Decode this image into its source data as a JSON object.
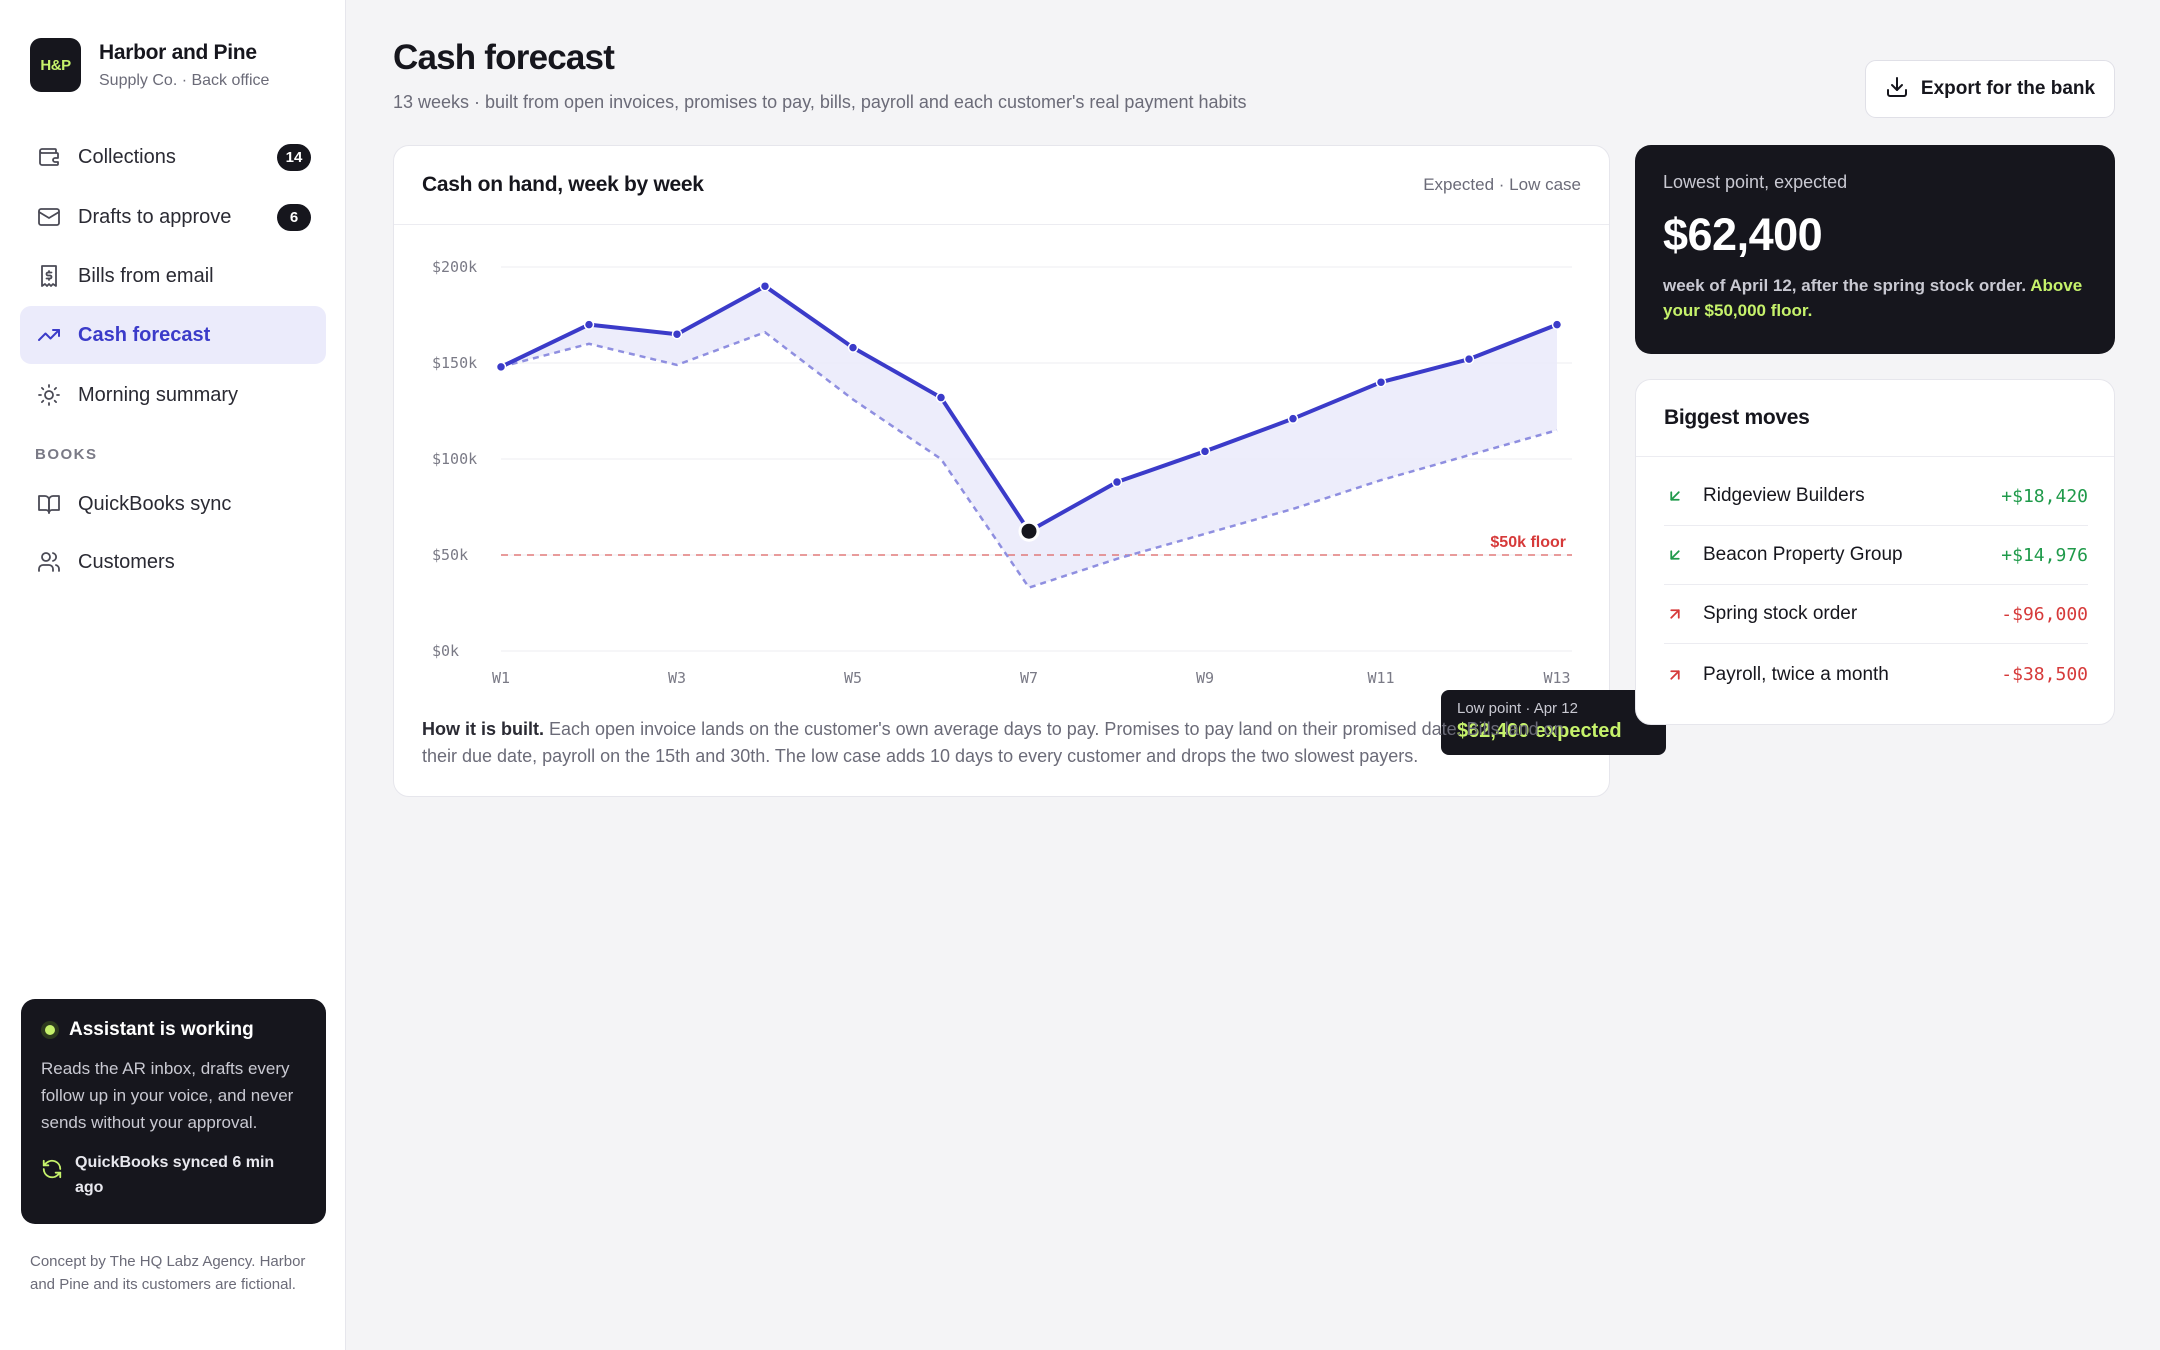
{
  "brand": {
    "logo": "H&P",
    "name": "Harbor and Pine",
    "sub": "Supply Co. · Back office"
  },
  "nav": {
    "items": [
      {
        "label": "Collections",
        "icon": "wallet-icon",
        "badge": "14"
      },
      {
        "label": "Drafts to approve",
        "icon": "mail-icon",
        "badge": "6"
      },
      {
        "label": "Bills from email",
        "icon": "receipt-icon"
      },
      {
        "label": "Cash forecast",
        "icon": "trend-icon",
        "active": true
      },
      {
        "label": "Morning summary",
        "icon": "sun-icon"
      }
    ],
    "books_heading": "BOOKS",
    "books": [
      {
        "label": "QuickBooks sync",
        "icon": "book-icon"
      },
      {
        "label": "Customers",
        "icon": "users-icon"
      }
    ]
  },
  "assistant": {
    "title": "Assistant is working",
    "body": "Reads the AR inbox, drafts every follow up in your voice, and never sends without your approval.",
    "sync": "QuickBooks synced 6 min ago"
  },
  "credit": "Concept by The HQ Labz Agency. Harbor and Pine and its customers are fictional.",
  "header": {
    "title": "Cash forecast",
    "subtitle": "13 weeks · built from open invoices, promises to pay, bills, payroll and each customer's real payment habits",
    "export_label": "Export for the bank"
  },
  "chart_card": {
    "title": "Cash on hand, week by week",
    "legend": "Expected · Low case",
    "tooltip_label": "Low point · Apr 12",
    "tooltip_value": "$62,400 expected",
    "floor_label": "$50k floor",
    "note_bold": "How it is built.",
    "note": " Each open invoice lands on the customer's own average days to pay. Promises to pay land on their promised date. Bills land on their due date, payroll on the 15th and 30th. The low case adds 10 days to every customer and drops the two slowest payers."
  },
  "chart_data": {
    "type": "line",
    "x": [
      "W1",
      "W2",
      "W3",
      "W4",
      "W5",
      "W6",
      "W7",
      "W8",
      "W9",
      "W10",
      "W11",
      "W12",
      "W13"
    ],
    "x_tick_labels": [
      "W1",
      "W3",
      "W5",
      "W7",
      "W9",
      "W11",
      "W13"
    ],
    "y_tick_labels": [
      "$0k",
      "$50k",
      "$100k",
      "$150k",
      "$200k"
    ],
    "ylim": [
      0,
      200000
    ],
    "series": [
      {
        "name": "Expected",
        "values": [
          148000,
          170000,
          165000,
          190000,
          158000,
          132000,
          62400,
          88000,
          104000,
          121000,
          140000,
          152000,
          170000
        ],
        "color": "#3b3bc9"
      },
      {
        "name": "Low case",
        "values": [
          148000,
          160000,
          149000,
          166000,
          131000,
          100000,
          33000,
          48000,
          61000,
          74000,
          89000,
          102000,
          115000
        ],
        "color": "#8f8fe0"
      }
    ],
    "floor": 50000,
    "highlight_index": 6,
    "grid": true
  },
  "lowest": {
    "label": "Lowest point, expected",
    "value": "$62,400",
    "note": "week of April 12, after the spring stock order.",
    "note_highlight": "Above your $50,000 floor."
  },
  "moves": {
    "title": "Biggest moves",
    "rows": [
      {
        "name": "Ridgeview Builders",
        "amount": "+$18,420",
        "direction": "in"
      },
      {
        "name": "Beacon Property Group",
        "amount": "+$14,976",
        "direction": "in"
      },
      {
        "name": "Spring stock order",
        "amount": "-$96,000",
        "direction": "out"
      },
      {
        "name": "Payroll, twice a month",
        "amount": "-$38,500",
        "direction": "out"
      }
    ]
  },
  "colors": {
    "accent": "#3b3bc9",
    "lime": "#c6f26b",
    "dark": "#16161d",
    "danger": "#d63a3a",
    "success": "#1f9a4a"
  }
}
